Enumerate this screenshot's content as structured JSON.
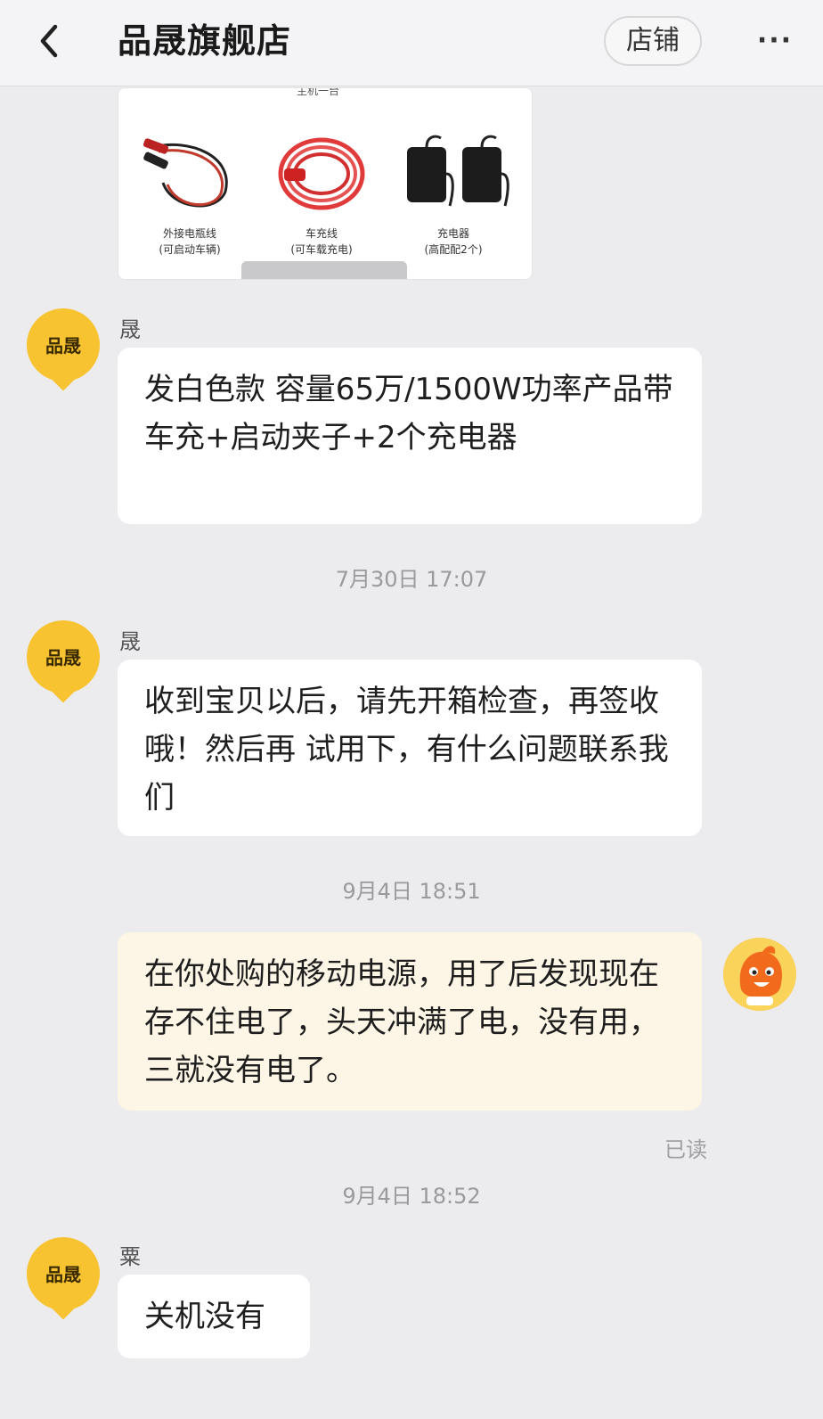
{
  "header": {
    "title": "品晟旗舰店",
    "store_button": "店铺",
    "more": "···"
  },
  "product_image": {
    "top_caption": "主机一台",
    "items": [
      {
        "line1": "外接电瓶线",
        "line2": "(可启动车辆)"
      },
      {
        "line1": "车充线",
        "line2": "(可车载充电)"
      },
      {
        "line1": "充电器",
        "line2": "(高配配2个)"
      }
    ]
  },
  "messages": [
    {
      "sender": "晟",
      "avatar_label": "品晟",
      "text": "发白色款  容量65万/1500W功率产品带 车充+启动夹子+2个充电器"
    },
    {
      "timestamp": "7月30日 17:07"
    },
    {
      "sender": "晟",
      "avatar_label": "品晟",
      "text": "收到宝贝以后，请先开箱检查，再签收哦！然后再 试用下，有什么问题联系我们"
    },
    {
      "timestamp": "9月4日 18:51"
    },
    {
      "mine": true,
      "text": "在你处购的移动电源，用了后发现现在存不住电了，头天冲满了电，没有用，三就没有电了。",
      "status": "已读"
    },
    {
      "timestamp": "9月4日 18:52"
    },
    {
      "sender": "粟",
      "avatar_label": "品晟",
      "text": "关机没有"
    }
  ],
  "colors": {
    "avatar_shop": "#f7c331",
    "mine_bubble": "#fdf6e6",
    "background": "#ececef"
  }
}
